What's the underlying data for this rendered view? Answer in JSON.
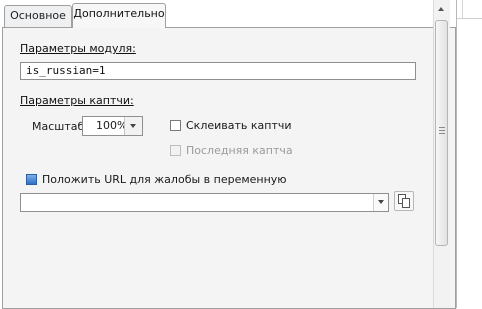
{
  "tabs": [
    {
      "label": "Основное",
      "active": false
    },
    {
      "label": "Дополнительно",
      "active": true
    }
  ],
  "module_params": {
    "label": "Параметры модуля:",
    "value": "is_russian=1"
  },
  "captcha_params": {
    "label": "Параметры каптчи:",
    "scale_label": "Масштаб",
    "scale_value": "100%",
    "glue_checkbox": {
      "label": "Склеивать каптчи",
      "checked": false,
      "enabled": true
    },
    "last_checkbox": {
      "label": "Последняя каптча",
      "checked": false,
      "enabled": false
    }
  },
  "url_complaint": {
    "label": "Положить URL для жалобы в переменную",
    "value": ""
  },
  "colors": {
    "panel_bg": "#f4f4f4",
    "border": "#a0a0a0",
    "accent_icon": "#2f6fc7"
  },
  "icons": {
    "copy": "copy-icon",
    "variable": "variable-icon",
    "dropdown": "chevron-down-icon",
    "scroll_up": "arrow-up-icon",
    "scroll_grip": "grip-icon"
  }
}
